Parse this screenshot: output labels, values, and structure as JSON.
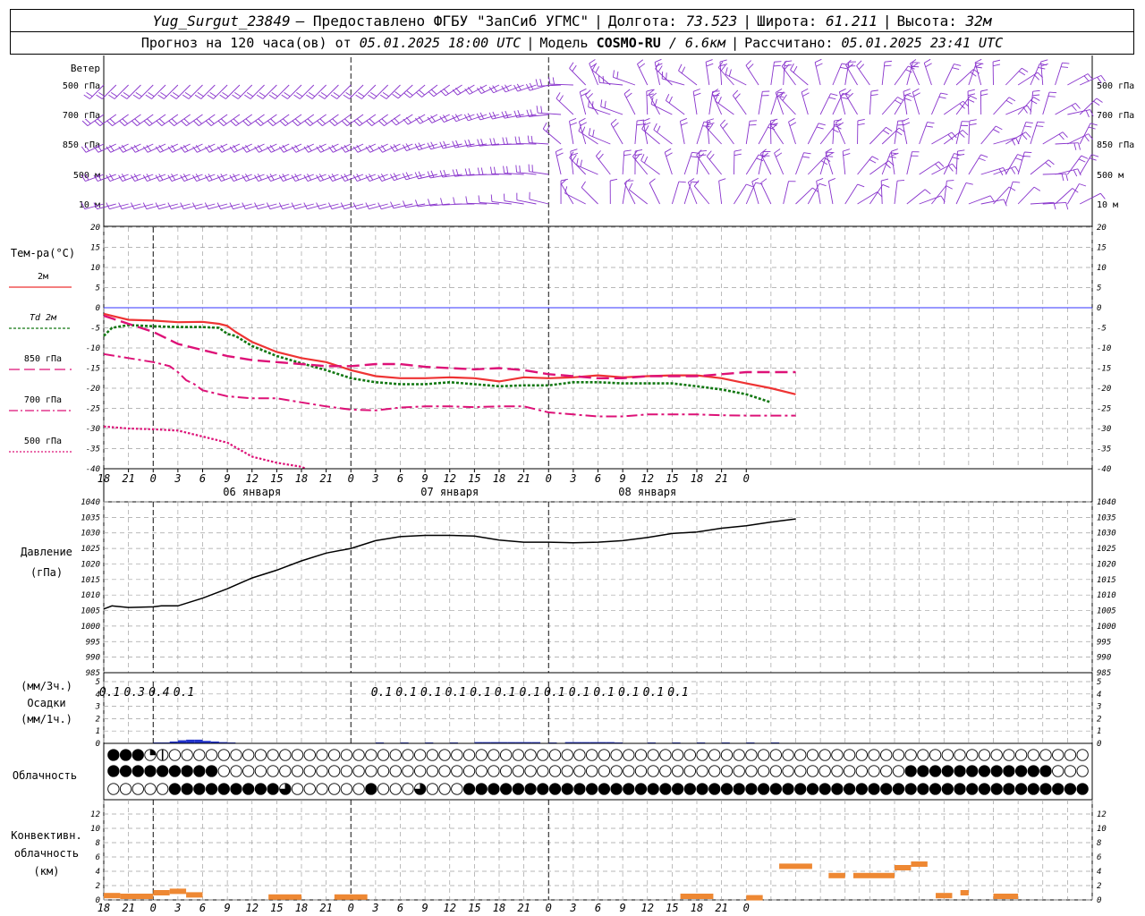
{
  "header": {
    "station": "Yug_Surgut_23849",
    "provider": "— Предоставлено ФГБУ \"ЗапСиб УГМС\"",
    "lon_label": "Долгота:",
    "lon_value": "73.523",
    "lat_label": "Широта:",
    "lat_value": "61.211",
    "alt_label": "Высота:",
    "alt_value": "32м",
    "forecast_label": "Прогноз на 120 часа(ов) от",
    "forecast_start": "05.01.2025 18:00 UTC",
    "model_label": "Модель",
    "model_name": "COSMO-RU",
    "model_res": "/ 6.6км",
    "calc_label": "Рассчитано:",
    "calc_value": "05.01.2025 23:41 UTC"
  },
  "labels": {
    "wind": "Ветер",
    "wind_levels": [
      "500 гПа",
      "700 гПа",
      "850 гПа",
      "500 м",
      "10 м"
    ],
    "temp_title": "Тем-ра(°C)",
    "temp_legend": [
      "2м",
      "Td 2м",
      "850 гПа",
      "700 гПа",
      "500 гПа"
    ],
    "pressure_title": "Давление",
    "pressure_unit": "(гПа)",
    "precip_top": "(мм/3ч.)",
    "precip_title": "Осадки",
    "precip_unit": "(мм/1ч.)",
    "cloud_title": "Облачность",
    "conv_title_1": "Конвективн.",
    "conv_title_2": "облачность",
    "conv_unit": "(км)"
  },
  "colors": {
    "t2m": "#ee3333",
    "td2m": "#117711",
    "t850": "#dd1177",
    "t700": "#dd1177",
    "t500": "#dd1177",
    "wind": "#8833cc",
    "zero_line": "#3333ff",
    "precip": "#2233cc",
    "conv": "#ee8833"
  },
  "chart_data": {
    "type": "line",
    "x_hours": [
      -6,
      114
    ],
    "x_tick_labels": [
      "18",
      "21",
      "0",
      "3",
      "6",
      "9",
      "12",
      "15",
      "18",
      "21",
      "0",
      "3",
      "6",
      "9",
      "12",
      "15",
      "18",
      "21",
      "0",
      "3",
      "6",
      "9",
      "12",
      "15",
      "18",
      "21",
      "0"
    ],
    "day_labels": [
      {
        "label": "06 января",
        "hour": 12
      },
      {
        "label": "07 января",
        "hour": 36
      },
      {
        "label": "08 января",
        "hour": 60
      }
    ],
    "temperature": {
      "ylim": [
        -40,
        20
      ],
      "ticks": [
        20,
        15,
        10,
        5,
        0,
        -5,
        -10,
        -15,
        -20,
        -25,
        -30,
        -35,
        -40
      ],
      "series": [
        {
          "name": "2м",
          "x": [
            -6,
            -3,
            0,
            3,
            6,
            8,
            9,
            10,
            12,
            15,
            18,
            21,
            24,
            27,
            30,
            33,
            36,
            39,
            42,
            45,
            48,
            51,
            54,
            57,
            60,
            63,
            66,
            69,
            72,
            75,
            78
          ],
          "y": [
            -1.5,
            -3,
            -3.2,
            -3.6,
            -3.5,
            -4,
            -4.5,
            -6,
            -8.5,
            -11,
            -12.5,
            -13.5,
            -15.5,
            -17,
            -17.5,
            -17.5,
            -17.3,
            -17.5,
            -18.3,
            -17.3,
            -17.5,
            -17.3,
            -16.8,
            -17.3,
            -17,
            -16.8,
            -16.8,
            -17.5,
            -18.8,
            -20,
            -21.5
          ]
        },
        {
          "name": "Td 2м",
          "x": [
            -6,
            -5,
            -3,
            0,
            3,
            6,
            8,
            9,
            10,
            12,
            15,
            18,
            21,
            24,
            27,
            30,
            33,
            36,
            39,
            42,
            45,
            48,
            51,
            54,
            57,
            60,
            63,
            66,
            69,
            72,
            75,
            78
          ],
          "y": [
            -7,
            -5,
            -4.3,
            -4.6,
            -4.8,
            -4.8,
            -5,
            -6.5,
            -7,
            -9.5,
            -12,
            -13.8,
            -15.5,
            -17.5,
            -18.5,
            -19,
            -19,
            -18.5,
            -19,
            -19.5,
            -19.3,
            -19.3,
            -18.5,
            -18.5,
            -18.8,
            -18.8,
            -18.8,
            -19.5,
            -20.3,
            -21.5,
            -23.5
          ]
        },
        {
          "name": "850 гПа",
          "x": [
            -6,
            -3,
            0,
            3,
            6,
            9,
            12,
            15,
            18,
            21,
            24,
            27,
            30,
            33,
            36,
            39,
            42,
            45,
            48,
            51,
            54,
            57,
            60,
            63,
            66,
            69,
            72,
            75,
            78
          ],
          "y": [
            -2,
            -4,
            -6,
            -9,
            -10.5,
            -12,
            -13,
            -13.5,
            -14,
            -14.5,
            -14.5,
            -14,
            -14,
            -14.7,
            -15,
            -15.3,
            -15,
            -15.5,
            -16.5,
            -17,
            -17.5,
            -17.5,
            -17,
            -17,
            -17,
            -16.5,
            -16,
            -16,
            -16
          ]
        },
        {
          "name": "700 гПа",
          "x": [
            -6,
            -3,
            0,
            1,
            2,
            3,
            4,
            5,
            6,
            7,
            9,
            12,
            15,
            18,
            21,
            24,
            27,
            30,
            33,
            36,
            39,
            42,
            45,
            48,
            51,
            54,
            57,
            60,
            63,
            66,
            69,
            72,
            75,
            78
          ],
          "y": [
            -11.5,
            -12.5,
            -13.5,
            -14,
            -14.5,
            -16,
            -18,
            -19,
            -20.5,
            -21,
            -22,
            -22.5,
            -22.5,
            -23.5,
            -24.5,
            -25.3,
            -25.5,
            -24.8,
            -24.5,
            -24.5,
            -24.7,
            -24.5,
            -24.5,
            -26,
            -26.5,
            -27,
            -27,
            -26.5,
            -26.5,
            -26.5,
            -26.7,
            -26.8,
            -26.8,
            -26.8
          ]
        },
        {
          "name": "500 гПа",
          "x": [
            -6,
            -3,
            0,
            3,
            6,
            9,
            12,
            15,
            18,
            18.5
          ],
          "y": [
            -29.5,
            -30,
            -30.2,
            -30.5,
            -32,
            -33.5,
            -37,
            -38.5,
            -39.5,
            -40
          ]
        }
      ]
    },
    "pressure": {
      "ylim": [
        985,
        1040
      ],
      "ticks": [
        1040,
        1035,
        1030,
        1025,
        1020,
        1015,
        1010,
        1005,
        1000,
        995,
        990,
        985
      ],
      "series": [
        {
          "name": "",
          "x": [
            -6,
            -5,
            -3,
            0,
            1,
            3,
            6,
            9,
            12,
            15,
            18,
            21,
            24,
            27,
            30,
            33,
            36,
            39,
            42,
            45,
            48,
            51,
            54,
            57,
            60,
            63,
            66,
            69,
            72,
            75,
            78
          ],
          "y": [
            1005.5,
            1006.5,
            1006,
            1006.2,
            1006.5,
            1006.5,
            1009,
            1012,
            1015.5,
            1018,
            1021,
            1023.5,
            1025,
            1027.5,
            1028.8,
            1029.2,
            1029.2,
            1029,
            1027.7,
            1027,
            1027,
            1026.8,
            1027,
            1027.5,
            1028.5,
            1029.8,
            1030.3,
            1031.5,
            1032.3,
            1033.5,
            1034.5
          ]
        }
      ]
    },
    "precip": {
      "ylim": [
        0,
        5
      ],
      "ticks": [
        5,
        4,
        3,
        2,
        1,
        0
      ],
      "labels_3h": [
        {
          "hour": -3,
          "text": "0.1"
        },
        {
          "hour": 0,
          "text": "0.3"
        },
        {
          "hour": 3,
          "text": "0.4"
        },
        {
          "hour": 6,
          "text": "0.1"
        },
        {
          "hour": 30,
          "text": "0.1"
        },
        {
          "hour": 33,
          "text": "0.1"
        },
        {
          "hour": 36,
          "text": "0.1"
        },
        {
          "hour": 39,
          "text": "0.1"
        },
        {
          "hour": 42,
          "text": "0.1"
        },
        {
          "hour": 45,
          "text": "0.1"
        },
        {
          "hour": 48,
          "text": "0.1"
        },
        {
          "hour": 51,
          "text": "0.1"
        },
        {
          "hour": 54,
          "text": "0.1"
        },
        {
          "hour": 57,
          "text": "0.1"
        },
        {
          "hour": 60,
          "text": "0.1"
        },
        {
          "hour": 63,
          "text": "0.1"
        },
        {
          "hour": 66,
          "text": "0.1"
        }
      ],
      "bars_1h": [
        [
          0,
          0.05
        ],
        [
          1,
          0.05
        ],
        [
          2,
          0.15
        ],
        [
          3,
          0.25
        ],
        [
          4,
          0.3
        ],
        [
          5,
          0.3
        ],
        [
          6,
          0.2
        ],
        [
          7,
          0.15
        ],
        [
          8,
          0.1
        ],
        [
          9,
          0.05
        ],
        [
          27,
          0.03
        ],
        [
          30,
          0.05
        ],
        [
          33,
          0.05
        ],
        [
          36,
          0.05
        ],
        [
          39,
          0.1
        ],
        [
          40,
          0.1
        ],
        [
          41,
          0.1
        ],
        [
          42,
          0.1
        ],
        [
          43,
          0.1
        ],
        [
          44,
          0.1
        ],
        [
          45,
          0.1
        ],
        [
          46,
          0.1
        ],
        [
          48,
          0.05
        ],
        [
          50,
          0.1
        ],
        [
          51,
          0.1
        ],
        [
          52,
          0.1
        ],
        [
          53,
          0.1
        ],
        [
          54,
          0.1
        ],
        [
          55,
          0.1
        ],
        [
          56,
          0.05
        ],
        [
          60,
          0.03
        ],
        [
          63,
          0.05
        ],
        [
          66,
          0.05
        ],
        [
          69,
          0.03
        ],
        [
          72,
          0.05
        ],
        [
          75,
          0.05
        ]
      ]
    },
    "clouds": {
      "rows": [
        "88831000000000000000000000000000000000000000000000000000000000000000000000000000",
        "88888888800000000000000000000000000000000000000000000000000000000888888888888000",
        "00000888888888500000080005000888888888888888888888888888888888888888888888888888"
      ]
    },
    "convective": {
      "ylim": [
        0,
        14
      ],
      "ticks": [
        12,
        10,
        8,
        6,
        4,
        2,
        0
      ],
      "segments": [
        [
          0,
          2,
          0.6
        ],
        [
          2,
          6,
          0.5
        ],
        [
          6,
          8,
          1.0
        ],
        [
          8,
          10,
          1.2
        ],
        [
          10,
          12,
          0.7
        ],
        [
          20,
          24,
          0.4
        ],
        [
          28,
          32,
          0.4
        ],
        [
          70,
          74,
          0.5
        ],
        [
          78,
          80,
          0.3
        ],
        [
          82,
          86,
          4.7
        ],
        [
          88,
          90,
          3.4
        ],
        [
          91,
          96,
          3.4
        ],
        [
          96,
          98,
          4.5
        ],
        [
          98,
          100,
          5
        ],
        [
          101,
          103,
          0.6
        ],
        [
          104,
          105,
          1
        ],
        [
          108,
          111,
          0.5
        ]
      ]
    }
  }
}
